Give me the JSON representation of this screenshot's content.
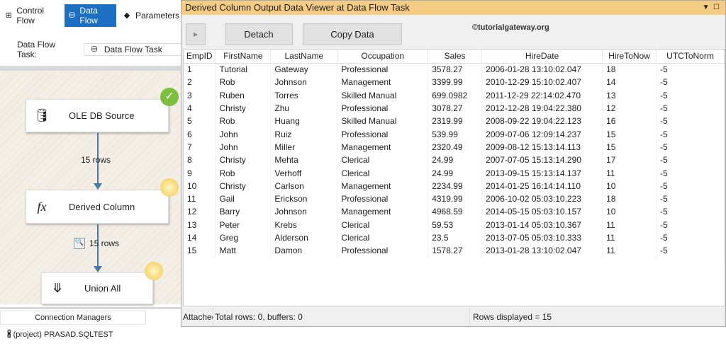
{
  "designer": {
    "tabs": [
      "Control Flow",
      "Data Flow",
      "Parameters"
    ],
    "task_label": "Data Flow Task:",
    "task_value": "Data Flow Task",
    "components": [
      "OLE DB Source",
      "Derived Column",
      "Union All"
    ],
    "path1": "15 rows",
    "path2": "15 rows",
    "conn_tab": "Connection Managers",
    "conn_item": "(project) PRASAD.SQLTEST"
  },
  "viewer": {
    "title": "Derived Column Output Data Viewer at Data Flow Task",
    "detach": "Detach",
    "copy": "Copy Data",
    "watermark": "©tutorialgateway.org",
    "columns": [
      "EmpID",
      "FirstName",
      "LastName",
      "Occupation",
      "Sales",
      "HireDate",
      "HireToNow",
      "UTCToNorm"
    ],
    "rows": [
      [
        "1",
        "Tutorial",
        "Gateway",
        "Professional",
        "3578.27",
        "2006-01-28 13:10:02.047",
        "18",
        "-5"
      ],
      [
        "2",
        "Rob",
        "Johnson",
        "Management",
        "3399.99",
        "2010-12-29 15:10:02.407",
        "14",
        "-5"
      ],
      [
        "3",
        "Ruben",
        "Torres",
        "Skilled Manual",
        "699.0982",
        "2011-12-29 22:14:02.470",
        "13",
        "-5"
      ],
      [
        "4",
        "Christy",
        "Zhu",
        "Professional",
        "3078.27",
        "2012-12-28 19:04:22.380",
        "12",
        "-5"
      ],
      [
        "5",
        "Rob",
        "Huang",
        "Skilled Manual",
        "2319.99",
        "2008-09-22 19:04:22.123",
        "16",
        "-5"
      ],
      [
        "6",
        "John",
        "Ruiz",
        "Professional",
        "539.99",
        "2009-07-06 12:09:14.237",
        "15",
        "-5"
      ],
      [
        "7",
        "John",
        "Miller",
        "Management",
        "2320.49",
        "2009-08-12 15:13:14.113",
        "15",
        "-5"
      ],
      [
        "8",
        "Christy",
        "Mehta",
        "Clerical",
        "24.99",
        "2007-07-05 15:13:14.290",
        "17",
        "-5"
      ],
      [
        "9",
        "Rob",
        "Verhoff",
        "Clerical",
        "24.99",
        "2013-09-15 15:13:14.137",
        "11",
        "-5"
      ],
      [
        "10",
        "Christy",
        "Carlson",
        "Management",
        "2234.99",
        "2014-01-25 16:14:14.110",
        "10",
        "-5"
      ],
      [
        "11",
        "Gail",
        "Erickson",
        "Professional",
        "4319.99",
        "2006-10-02 05:03:10.223",
        "18",
        "-5"
      ],
      [
        "12",
        "Barry",
        "Johnson",
        "Management",
        "4968.59",
        "2014-05-15 05:03:10.157",
        "10",
        "-5"
      ],
      [
        "13",
        "Peter",
        "Krebs",
        "Clerical",
        "59.53",
        "2013-01-14 05:03:10.367",
        "11",
        "-5"
      ],
      [
        "14",
        "Greg",
        "Alderson",
        "Clerical",
        "23.5",
        "2013-07-05 05:03:10.333",
        "11",
        "-5"
      ],
      [
        "15",
        "Matt",
        "Damon",
        "Professional",
        "1578.27",
        "2013-01-28 13:10:02.047",
        "11",
        "-5"
      ]
    ],
    "status_attach": "Attached",
    "status_total": "Total rows: 0, buffers: 0",
    "status_displayed": "Rows displayed = 15"
  }
}
